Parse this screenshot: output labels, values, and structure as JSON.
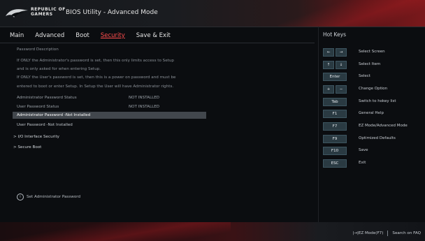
{
  "header": {
    "brand_line1": "REPUBLIC OF",
    "brand_line2": "GAMERS",
    "title": "BIOS Utility - Advanced Mode"
  },
  "tabs": [
    {
      "label": "Main",
      "active": false
    },
    {
      "label": "Advanced",
      "active": false
    },
    {
      "label": "Boot",
      "active": false
    },
    {
      "label": "Security",
      "active": true
    },
    {
      "label": "Save & Exit",
      "active": false
    }
  ],
  "security": {
    "password_description": "Password Description",
    "desc_lines": [
      "If ONLY the Administrator's password is set, then this only limits access to Setup",
      "and is only asked for when entering Setup.",
      "If ONLY the User's password is set, then this is a power on password and must be",
      "entered to boot or enter Setup. In Setup the User will have Administrator rights."
    ],
    "admin_status_label": "Administrator Password Status",
    "admin_status_value": "NOT INSTALLED",
    "user_status_label": "User Password Status",
    "user_status_value": "NOT INSTALLED",
    "admin_password_item": "Administrator Password -Not Installed",
    "user_password_item": "User Password -Not Installed",
    "io_interface_security": "I/O Interface Security",
    "secure_boot": "Secure Boot",
    "help_text": "Set Administrator Password",
    "help_icon": "info-icon"
  },
  "hotkeys": {
    "title": "Hot Keys",
    "items": [
      {
        "key1": "←",
        "key2": "→",
        "label": "Select Screen"
      },
      {
        "key1": "↑",
        "key2": "↓",
        "label": "Select Item"
      },
      {
        "key": "Enter",
        "label": "Select"
      },
      {
        "key1": "+",
        "key2": "−",
        "label": "Change Option"
      },
      {
        "key": "Tab",
        "label": "Switch to hokey list"
      },
      {
        "key": "F1",
        "label": "General Help"
      },
      {
        "key": "F7",
        "label": "EZ Mode/Advanced Mode"
      },
      {
        "key": "F9",
        "label": "Optimized Defaults"
      },
      {
        "key": "F10",
        "label": "Save"
      },
      {
        "key": "ESC",
        "label": "Exit"
      }
    ]
  },
  "footer": {
    "ez_mode": "|→|EZ Mode(F7)",
    "search": "Search on FAQ"
  },
  "colors": {
    "accent_red": "#ff4d4d",
    "selected_row_bg": "#42474d",
    "hotkey_bg": "#2a3a42"
  }
}
